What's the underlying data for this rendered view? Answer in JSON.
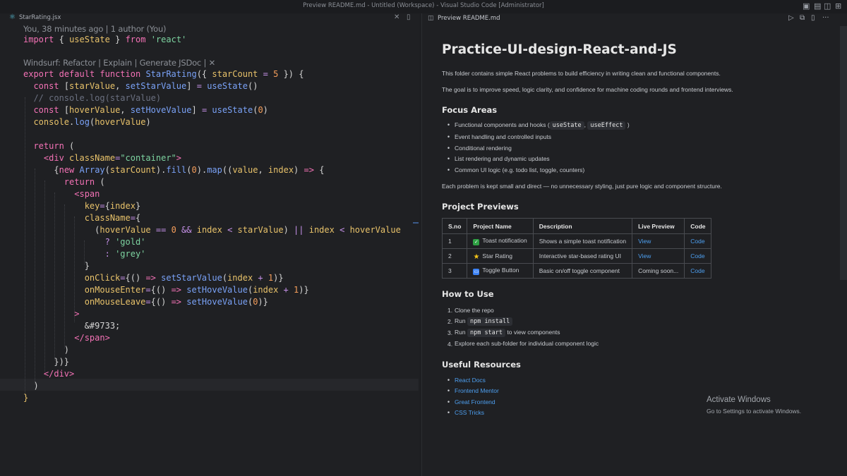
{
  "window": {
    "title": "Preview README.md - Untitled (Workspace) - Visual Studio Code [Administrator]"
  },
  "editor": {
    "tab_label": "StarRating.jsx",
    "blame": "You, 38 minutes ago | 1 author (You)",
    "codelens": "Windsurf: Refactor | Explain | Generate JSDoc | ✕"
  },
  "preview": {
    "tab_label": "Preview README.md",
    "title": "Practice-UI-design-React-and-JS",
    "intro1": "This folder contains simple React problems to build efficiency in writing clean and functional components.",
    "intro2": "The goal is to improve speed, logic clarity, and confidence for machine coding rounds and frontend interviews.",
    "focus_heading": "Focus Areas",
    "focus_items": [
      "Functional components and hooks (",
      "Event handling and controlled inputs",
      "Conditional rendering",
      "List rendering and dynamic updates",
      "Common UI logic (e.g. todo list, toggle, counters)"
    ],
    "hook1": "useState",
    "hook_sep": ",",
    "hook2": "useEffect",
    "hook_end": ")",
    "summary": "Each problem is kept small and direct — no unnecessary styling, just pure logic and component structure.",
    "previews_heading": "Project Previews",
    "table_headers": [
      "S.no",
      "Project Name",
      "Description",
      "Live Preview",
      "Code"
    ],
    "table_rows": [
      {
        "sno": "1",
        "name": "Toast notification",
        "desc": "Shows a simple toast notification",
        "live": "View",
        "code": "Code"
      },
      {
        "sno": "2",
        "name": "Star Rating",
        "desc": "Interactive star-based rating UI",
        "live": "View",
        "code": "Code"
      },
      {
        "sno": "3",
        "name": "Toggle Button",
        "desc": "Basic on/off toggle component",
        "live": "Coming soon...",
        "code": "Code"
      }
    ],
    "howto_heading": "How to Use",
    "howto_nums": [
      "1.",
      "2.",
      "3.",
      "4."
    ],
    "howto1": "Clone the repo",
    "howto2_pre": "Run",
    "howto2_code": "npm install",
    "howto3_pre": "Run",
    "howto3_code": "npm start",
    "howto3_post": "to view components",
    "howto4": "Explore each sub-folder for individual component logic",
    "resources_heading": "Useful Resources",
    "resources": [
      "React Docs",
      "Frontend Mentor",
      "Great Frontend",
      "CSS Tricks"
    ],
    "activate_title": "Activate Windows",
    "activate_sub": "Go to Settings to activate Windows."
  },
  "colors": {
    "editor_bg": "#1f2023",
    "keyword": "#f472b6",
    "function": "#7aa2f7",
    "string": "#7dd3a0",
    "link": "#4d9ff0"
  }
}
